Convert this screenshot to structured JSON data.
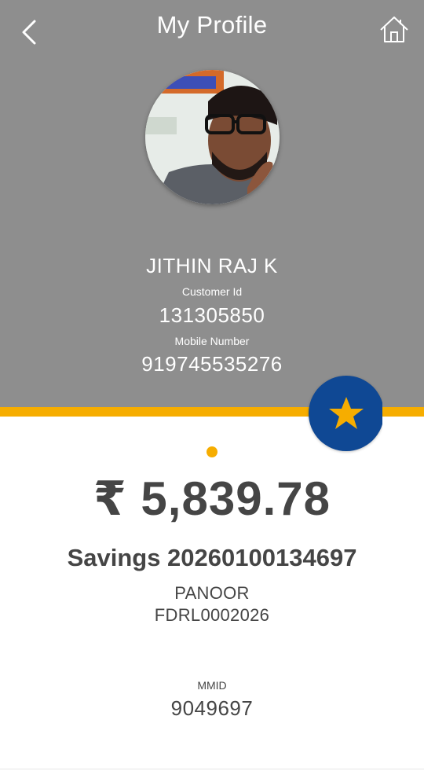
{
  "header": {
    "title": "My Profile",
    "back_icon": "chevron-left-icon",
    "home_icon": "home-icon",
    "background_color": "#8e8e8e"
  },
  "profile": {
    "name": "JITHIN RAJ K",
    "customer_id_label": "Customer Id",
    "customer_id": "131305850",
    "mobile_label": "Mobile Number",
    "mobile_number": "919745535276"
  },
  "badge": {
    "icon": "star-icon",
    "color": "#0f4894",
    "star_color": "#f6ad00"
  },
  "account": {
    "balance": "₹ 5,839.78",
    "account_title": "Savings 20260100134697",
    "branch": "PANOOR",
    "ifsc": "FDRL0002026",
    "mmid_label": "MMID",
    "mmid": "9049697"
  },
  "colors": {
    "accent": "#f6ad00",
    "text_dark": "#454545"
  }
}
